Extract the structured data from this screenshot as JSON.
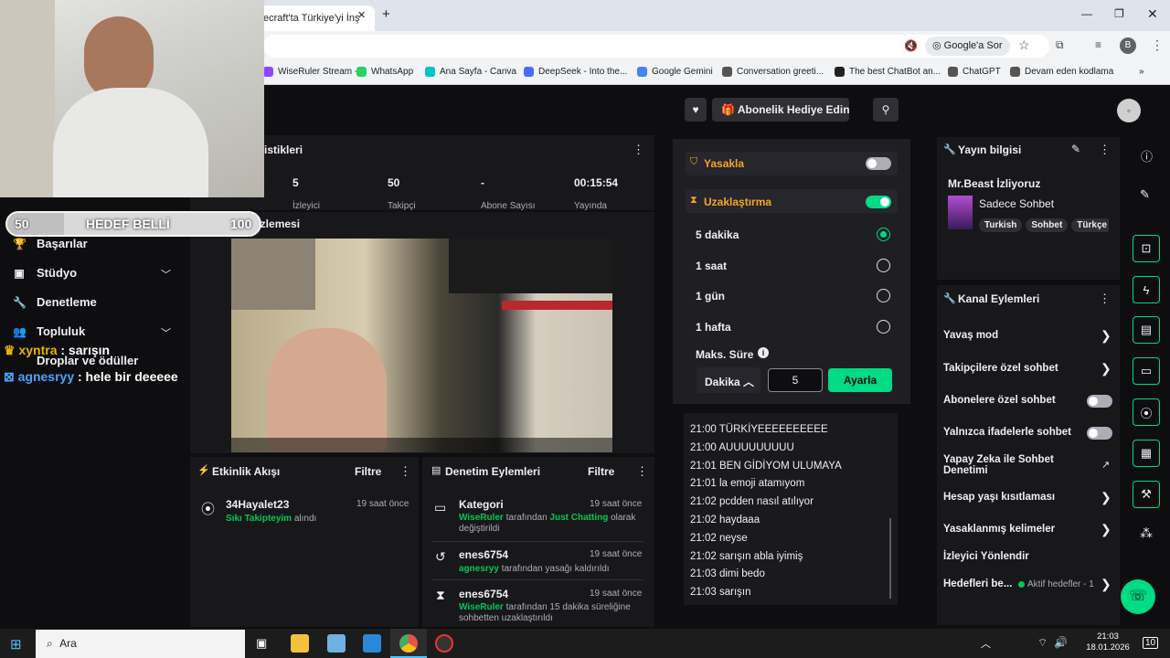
{
  "browser": {
    "tab_title": "ecraft'ta Türkiye'yi İnş",
    "google_btn": "Google'a Sor",
    "avatar_letter": "B",
    "bookmarks": [
      {
        "label": "WiseRuler Stream -...",
        "color": "#9146ff"
      },
      {
        "label": "WhatsApp",
        "color": "#25d366"
      },
      {
        "label": "Ana Sayfa - Canva",
        "color": "#00c4cc"
      },
      {
        "label": "DeepSeek - Into the...",
        "color": "#4d6bfe"
      },
      {
        "label": "Google Gemini",
        "color": "#4285f4"
      },
      {
        "label": "Conversation greeti...",
        "color": "#555555"
      },
      {
        "label": "The best ChatBot an...",
        "color": "#222222"
      },
      {
        "label": "ChatGPT",
        "color": "#555555"
      },
      {
        "label": "Devam eden kodlama",
        "color": "#555555"
      }
    ]
  },
  "overlay": {
    "goal_left": "50",
    "goal_title": "HEDEF BELLİ",
    "goal_right": "100",
    "chat1_user": "xyntra",
    "chat1_msg": " : sarışın",
    "chat2_user": "agnesryy",
    "chat2_msg": " : hele bir deeeee"
  },
  "sidebar": {
    "items": [
      {
        "label": "Başarılar",
        "icon": "trophy-icon"
      },
      {
        "label": "Stüdyo",
        "icon": "video-icon"
      },
      {
        "label": "Denetleme",
        "icon": "wrench-icon"
      },
      {
        "label": "Topluluk",
        "icon": "people-icon"
      },
      {
        "label": "Droplar ve ödüller",
        "icon": "gift-icon"
      }
    ]
  },
  "stats": {
    "title": "istikleri",
    "items": [
      {
        "value": "5",
        "label": "İzleyici"
      },
      {
        "value": "50",
        "label": "Takipçi"
      },
      {
        "value": "-",
        "label": "Abone Sayısı"
      },
      {
        "value": "00:15:54",
        "label": "Yayında"
      }
    ]
  },
  "preview": {
    "title": "Yayın önizlemesi"
  },
  "activity": {
    "title": "Etkinlik Akışı",
    "filter": "Filtre",
    "event_user": "34Hayalet23",
    "event_time": "19 saat önce",
    "event_green": "Sıkı Takipteyim",
    "event_rest": " alındı"
  },
  "modactions": {
    "title": "Denetim Eylemleri",
    "filter": "Filtre",
    "items": [
      {
        "title": "Kategori",
        "time": "19 saat önce",
        "actor": "WiseRuler",
        "t1": " tarafından ",
        "green2": "Just Chatting",
        "t2": " olarak değiştirildi"
      },
      {
        "title": "enes6754",
        "time": "19 saat önce",
        "actor": "agnesryy",
        "t1": " tarafından yasağı kaldırıldı",
        "green2": "",
        "t2": ""
      },
      {
        "title": "enes6754",
        "time": "19 saat önce",
        "actor": "WiseRuler",
        "t1": " tarafından 15 dakika süreliğine sohbetten uzaklaştırıldı",
        "green2": "",
        "t2": ""
      }
    ]
  },
  "mod_panel": {
    "gift_label": "Abonelik Hediye Edin",
    "ban_label": "Yasakla",
    "timeout_label": "Uzaklaştırma",
    "options": [
      "5 dakika",
      "1 saat",
      "1 gün",
      "1 hafta"
    ],
    "max_label": "Maks. Süre",
    "unit": "Dakika",
    "input_value": "5",
    "apply": "Ayarla"
  },
  "chat_log": [
    "21:00 TÜRKİYEEEEEEEEEE",
    "21:00 AUUUUUUUUU",
    "21:01 BEN GİDİYOM ULUMAYA",
    "21:01 la emoji atamıyom",
    "21:02 pcdden nasıl atılıyor",
    "21:02 haydaaa",
    "21:02 neyse",
    "21:02 sarışın abla iyimiş",
    "21:03 dimi bedo",
    "21:03 sarışın"
  ],
  "stream_info": {
    "title": "Yayın bilgisi",
    "stream_title": "Mr.Beast İzliyoruz",
    "category": "Sadece Sohbet",
    "tags": [
      "Turkish",
      "Sohbet",
      "Türkçe"
    ]
  },
  "channel_actions": {
    "title": "Kanal Eylemleri",
    "rows": [
      {
        "label": "Yavaş mod",
        "control": "arrow"
      },
      {
        "label": "Takipçilere özel sohbet",
        "control": "arrow"
      },
      {
        "label": "Abonelere özel sohbet",
        "control": "toggle"
      },
      {
        "label": "Yalnızca ifadelerle sohbet",
        "control": "toggle"
      },
      {
        "label": "Yapay Zeka ile Sohbet Denetimi",
        "control": "external"
      },
      {
        "label": "Hesap yaşı kısıtlaması",
        "control": "arrow"
      },
      {
        "label": "Yasaklanmış kelimeler",
        "control": "arrow"
      },
      {
        "label": "İzleyici Yönlendir",
        "control": "none"
      },
      {
        "label": "Hedefleri be...",
        "control": "arrow"
      }
    ],
    "goals_status": "Aktif hedefler - 1"
  },
  "taskbar": {
    "search": "Ara",
    "time": "21:03",
    "date": "18.01.2026",
    "notif": "10"
  }
}
